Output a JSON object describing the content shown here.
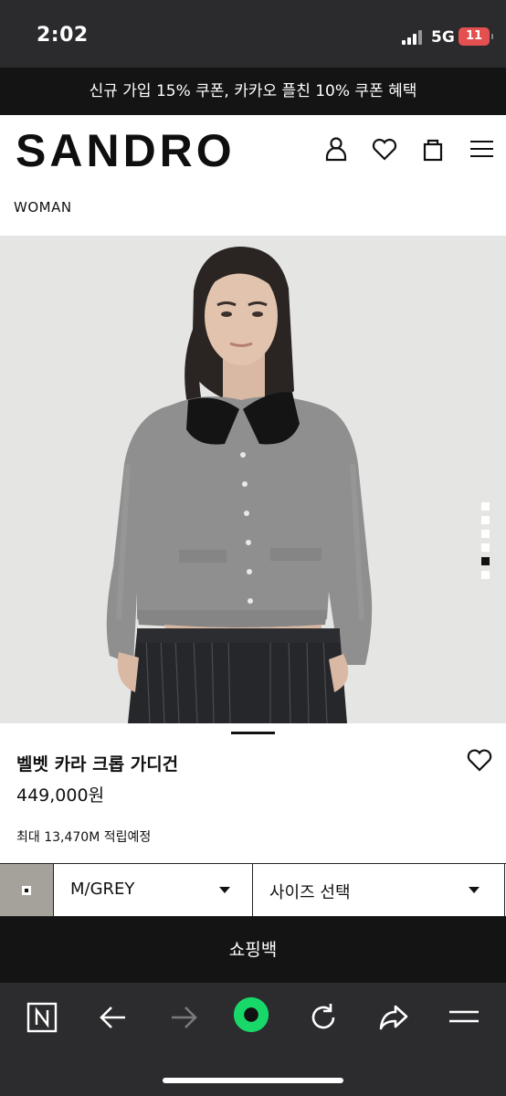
{
  "status_bar": {
    "time": "2:02",
    "network": "5G",
    "battery": "11"
  },
  "promo": {
    "text": "신규 가입 15% 쿠폰, 카카오 플친 10% 쿠폰 혜택"
  },
  "header": {
    "logo": "SANDRO",
    "icons": [
      "user-icon",
      "heart-icon",
      "shopping-bag-icon",
      "menu-icon"
    ]
  },
  "breadcrumb": "WOMAN",
  "gallery": {
    "image_count": 6,
    "active_index": 5
  },
  "product": {
    "title": "벨벳 카라 크롭 가디건",
    "price": "449,000원",
    "points": "최대 13,470M 적립예정"
  },
  "options": {
    "color_value": "M/GREY",
    "size_placeholder": "사이즈 선택",
    "swatch_color": "#a5a29c"
  },
  "cart_button": "쇼핑백",
  "browser": {
    "icons": [
      "naver-icon",
      "back-arrow-icon",
      "forward-arrow-icon",
      "green-circle-icon",
      "reload-icon",
      "share-icon",
      "menu-icon"
    ],
    "accent": "#19d86a"
  }
}
